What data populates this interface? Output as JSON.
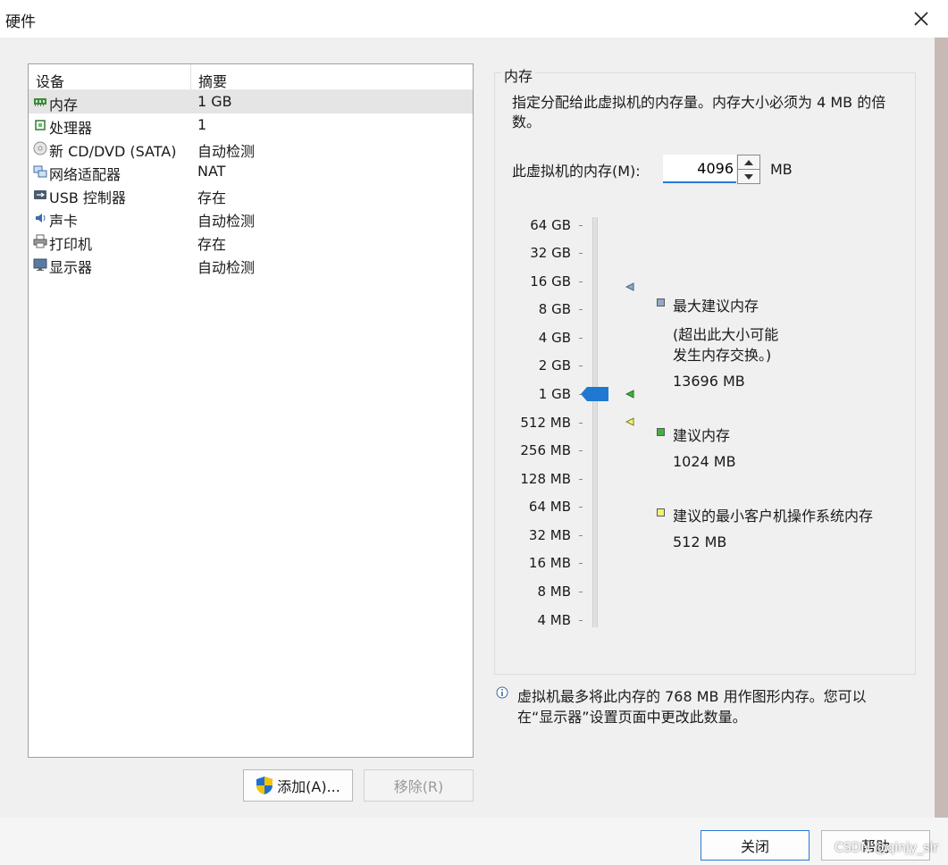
{
  "window": {
    "title": "硬件"
  },
  "devices": {
    "col_device": "设备",
    "col_summary": "摘要",
    "rows": [
      {
        "icon": "memory-icon",
        "name": "内存",
        "summary": "1 GB"
      },
      {
        "icon": "processor-icon",
        "name": "处理器",
        "summary": "1"
      },
      {
        "icon": "cd-dvd-icon",
        "name": "新 CD/DVD (SATA)",
        "summary": "自动检测"
      },
      {
        "icon": "network-adapter-icon",
        "name": "网络适配器",
        "summary": "NAT"
      },
      {
        "icon": "usb-icon",
        "name": "USB 控制器",
        "summary": "存在"
      },
      {
        "icon": "sound-card-icon",
        "name": "声卡",
        "summary": "自动检测"
      },
      {
        "icon": "printer-icon",
        "name": "打印机",
        "summary": "存在"
      },
      {
        "icon": "display-icon",
        "name": "显示器",
        "summary": "自动检测"
      }
    ],
    "selected_index": 0,
    "add_button": "添加(A)...",
    "remove_button": "移除(R)"
  },
  "memory": {
    "group_title": "内存",
    "description": "指定分配给此虚拟机的内存量。内存大小必须为 4 MB 的倍数。",
    "field_label": "此虚拟机的内存(M):",
    "field_value": "4096",
    "unit": "MB",
    "scale": [
      "64 GB",
      "32 GB",
      "16 GB",
      "8 GB",
      "4 GB",
      "2 GB",
      "1 GB",
      "512 MB",
      "256 MB",
      "128 MB",
      "64 MB",
      "32 MB",
      "16 MB",
      "8 MB",
      "4 MB"
    ],
    "slider_value": "1 GB",
    "legend": {
      "max_title": "最大建议内存",
      "max_note_line1": "(超出此大小可能",
      "max_note_line2": "发生内存交换。)",
      "max_value": "13696 MB",
      "recommended_title": "建议内存",
      "recommended_value": "1024 MB",
      "min_title": "建议的最小客户机操作系统内存",
      "min_value": "512 MB"
    },
    "colors": {
      "max": "#8fa8cc",
      "recommended": "#3cb43c",
      "min": "#f2f270",
      "thumb": "#1f78d1"
    }
  },
  "info": {
    "line1": "虚拟机最多将此内存的 768 MB 用作图形内存。您可以",
    "line2": "在“显示器”设置页面中更改此数量。"
  },
  "footer": {
    "close_button": "关闭",
    "help_button": "帮助",
    "watermark": "CSDN @qinjy_sir"
  }
}
